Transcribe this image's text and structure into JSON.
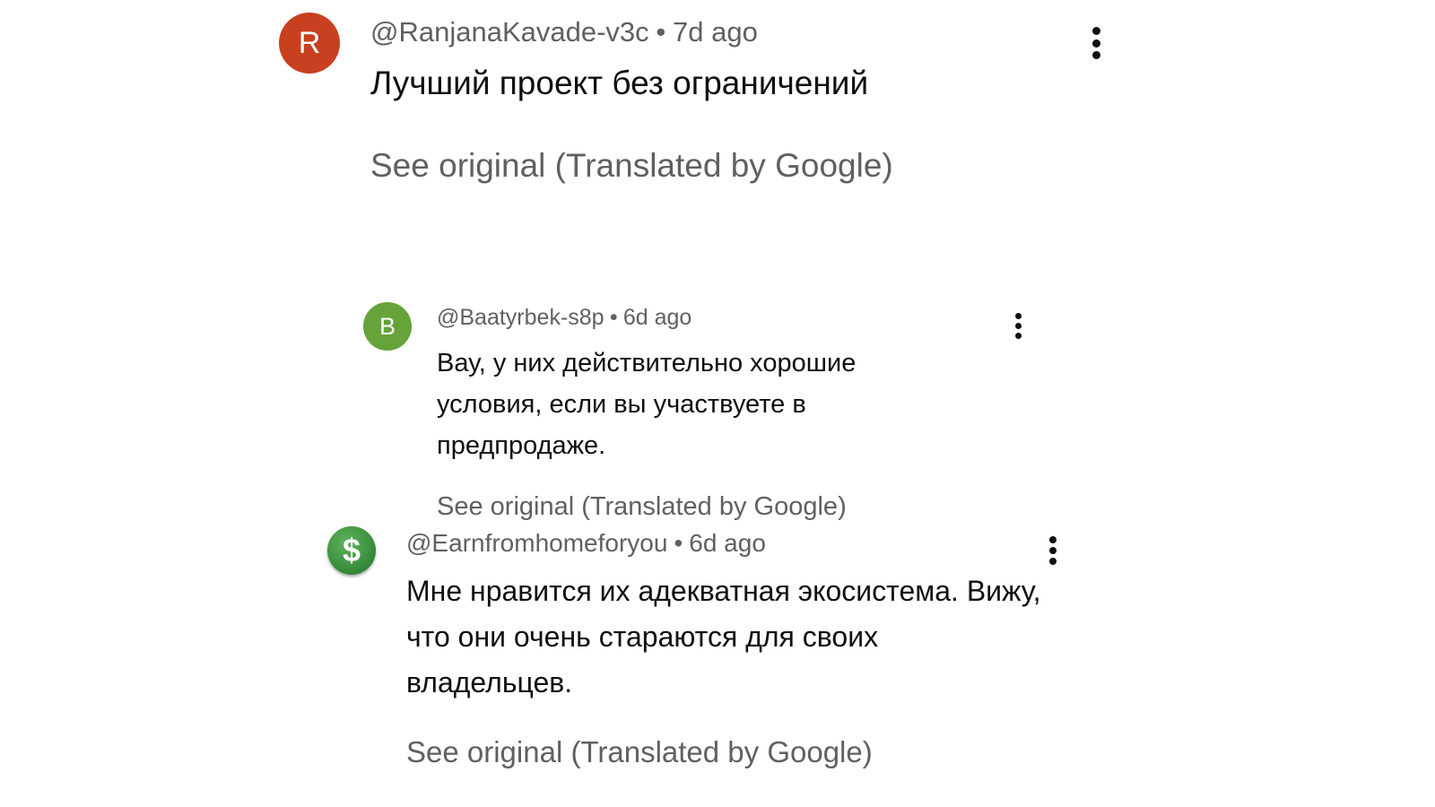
{
  "colors": {
    "avatar_r": "#c8401f",
    "avatar_b": "#66a33a",
    "avatar_dollar": "#3a8f3c",
    "meta_text": "#606060",
    "body_text": "#0f0f0f"
  },
  "comments": [
    {
      "avatar_letter": "R",
      "author": "@RanjanaKavade-v3c",
      "separator": "•",
      "time": "7d ago",
      "text": "Лучший проект без ограничений",
      "see_original": "See original (Translated by Google)",
      "menu_icon": "more-vert-icon"
    },
    {
      "avatar_letter": "B",
      "author": "@Baatyrbek-s8p",
      "separator": "•",
      "time": "6d ago",
      "text": "Вау, у них действительно хорошие условия, если вы участвуете в предпродаже.",
      "see_original": "See original (Translated by Google)",
      "menu_icon": "more-vert-icon"
    },
    {
      "avatar_letter": "$",
      "author": "@Earnfromhomeforyou",
      "separator": "•",
      "time": "6d ago",
      "text": "Мне нравится их адекватная экосистема. Вижу, что они очень стараются для своих владельцев.",
      "see_original": "See original (Translated by Google)",
      "menu_icon": "more-vert-icon"
    }
  ]
}
